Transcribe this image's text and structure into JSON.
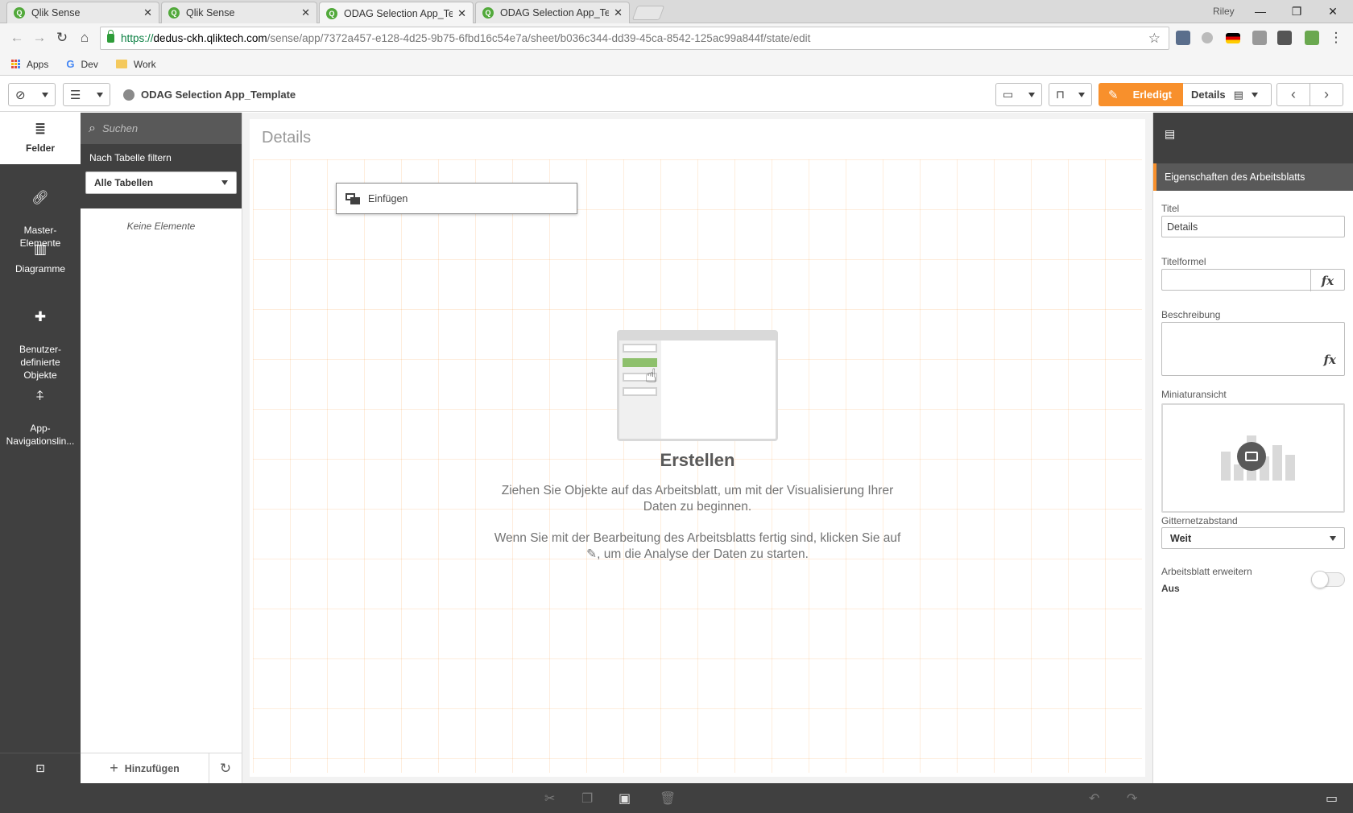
{
  "browser": {
    "tabs": [
      {
        "title": "Qlik Sense",
        "active": false
      },
      {
        "title": "Qlik Sense",
        "active": false
      },
      {
        "title": "ODAG Selection App_Ten",
        "active": true
      },
      {
        "title": "ODAG Selection App_Ten",
        "active": false
      }
    ],
    "profile": "Riley",
    "url": {
      "scheme": "https://",
      "host": "dedus-ckh.qliktech.com",
      "path": "/sense/app/7372a457-e128-4d25-9b75-6fbd16c54e7a/sheet/b036c344-dd39-45ca-8542-125ac99a844f/state/edit"
    },
    "bookmarks": [
      "Apps",
      "Dev",
      "Work"
    ]
  },
  "toolbar": {
    "app_title": "ODAG Selection App_Template",
    "done_label": "Erledigt",
    "sheet_label": "Details",
    "accent": "#f8902c"
  },
  "left_nav": {
    "items": [
      {
        "label": "Felder",
        "icon": "database-icon",
        "active": true
      },
      {
        "label": "Master-\nElemente",
        "icon": "link-icon",
        "active": false
      },
      {
        "label": "Diagramme",
        "icon": "bar-chart-icon",
        "active": false
      },
      {
        "label": "Benutzer-\ndefinierte\nObjekte",
        "icon": "puzzle-icon",
        "active": false
      },
      {
        "label": "App-\nNavigationslin...",
        "icon": "signpost-icon",
        "active": false
      }
    ]
  },
  "fields_panel": {
    "search_placeholder": "Suchen",
    "filter_label": "Nach Tabelle filtern",
    "filter_value": "Alle Tabellen",
    "empty_text": "Keine Elemente",
    "add_label": "Hinzufügen"
  },
  "sheet": {
    "title": "Details",
    "insert_label": "Einfügen",
    "empty_title": "Erstellen",
    "empty_text_1": "Ziehen Sie Objekte auf das Arbeitsblatt, um mit der Visualisierung Ihrer Daten zu beginnen.",
    "empty_text_2a": "Wenn Sie mit der Bearbeitung des Arbeitsblatts fertig sind, klicken Sie auf",
    "empty_text_2b": ", um die Analyse der Daten zu starten."
  },
  "properties": {
    "header": "Eigenschaften des Arbeitsblatts",
    "title_label": "Titel",
    "title_value": "Details",
    "title_formula_label": "Titelformel",
    "title_formula_value": "",
    "description_label": "Beschreibung",
    "thumbnail_label": "Miniaturansicht",
    "grid_spacing_label": "Gitternetzabstand",
    "grid_spacing_value": "Weit",
    "extend_sheet_label": "Arbeitsblatt erweitern",
    "extend_sheet_value": "Aus",
    "fx": "fx"
  }
}
